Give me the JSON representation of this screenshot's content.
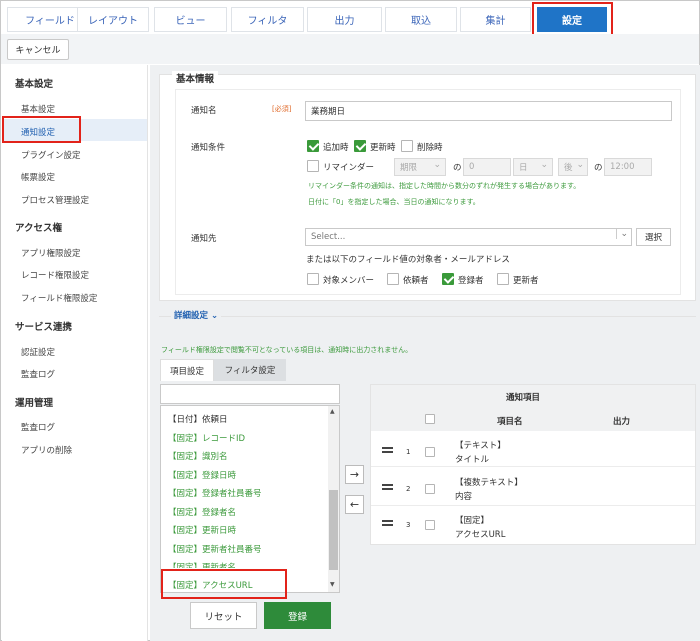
{
  "tabs": [
    "フィールド",
    "レイアウト",
    "ビュー",
    "フィルタ",
    "出力",
    "取込",
    "集計",
    "設定"
  ],
  "toolbar": {
    "cancel": "キャンセル"
  },
  "sidebar": {
    "groups": [
      {
        "title": "基本設定",
        "items": [
          "基本設定",
          "通知設定",
          "プラグイン設定",
          "帳票設定",
          "プロセス管理設定"
        ]
      },
      {
        "title": "アクセス権",
        "items": [
          "アプリ権限設定",
          "レコード権限設定",
          "フィールド権限設定"
        ]
      },
      {
        "title": "サービス連携",
        "items": [
          "認証設定",
          "監査ログ"
        ]
      },
      {
        "title": "運用管理",
        "items": [
          "監査ログ",
          "アプリの削除"
        ]
      }
    ]
  },
  "basic": {
    "title": "基本情報",
    "name_label": "通知名",
    "required": "[必須]",
    "name_value": "業務期日",
    "cond_label": "通知条件",
    "cond_add": "追加時",
    "cond_update": "更新時",
    "cond_delete": "削除時",
    "reminder": "リマインダー",
    "rem_field": "期限",
    "rem_no1": "の",
    "rem_value": "0",
    "rem_unit": "日",
    "rem_dir": "後",
    "rem_no2": "の",
    "rem_time": "12:00",
    "hint1": "リマインダー条件の通知は、指定した時間から数分のずれが発生する場合があります。",
    "hint2": "日付に「0」を指定した場合、当日の通知になります。",
    "dest_label": "通知先",
    "select_placeholder": "Select...",
    "select_btn": "選択",
    "or_text": "または以下のフィールド値の対象者・メールアドレス",
    "t_members": "対象メンバー",
    "t_requester": "依頼者",
    "t_registrant": "登録者",
    "t_updater": "更新者"
  },
  "detail": {
    "title": "詳細設定"
  },
  "note": "フィールド権限設定で閲覧不可となっている項目は、通知時に出力されません。",
  "subtabs": [
    "項目設定",
    "フィルタ設定"
  ],
  "left_list": [
    "【日付】依頼日",
    "【固定】レコードID",
    "【固定】識別名",
    "【固定】登録日時",
    "【固定】登録者社員番号",
    "【固定】登録者名",
    "【固定】更新日時",
    "【固定】更新者社員番号",
    "【固定】更新者名",
    "【固定】アクセスURL"
  ],
  "arrows": {
    "add": "→",
    "remove": "←"
  },
  "notify": {
    "title": "通知項目",
    "col_name": "項目名",
    "col_output": "出力",
    "rows": [
      {
        "no": "1",
        "type": "【テキスト】",
        "name": "タイトル"
      },
      {
        "no": "2",
        "type": "【複数テキスト】",
        "name": "内容"
      },
      {
        "no": "3",
        "type": "【固定】",
        "name": "アクセスURL"
      }
    ]
  },
  "buttons": {
    "reset": "リセット",
    "register": "登録"
  },
  "colors": {
    "accent": "#1f74c7",
    "green": "#2e8b3a",
    "highlight": "#e2231a"
  }
}
